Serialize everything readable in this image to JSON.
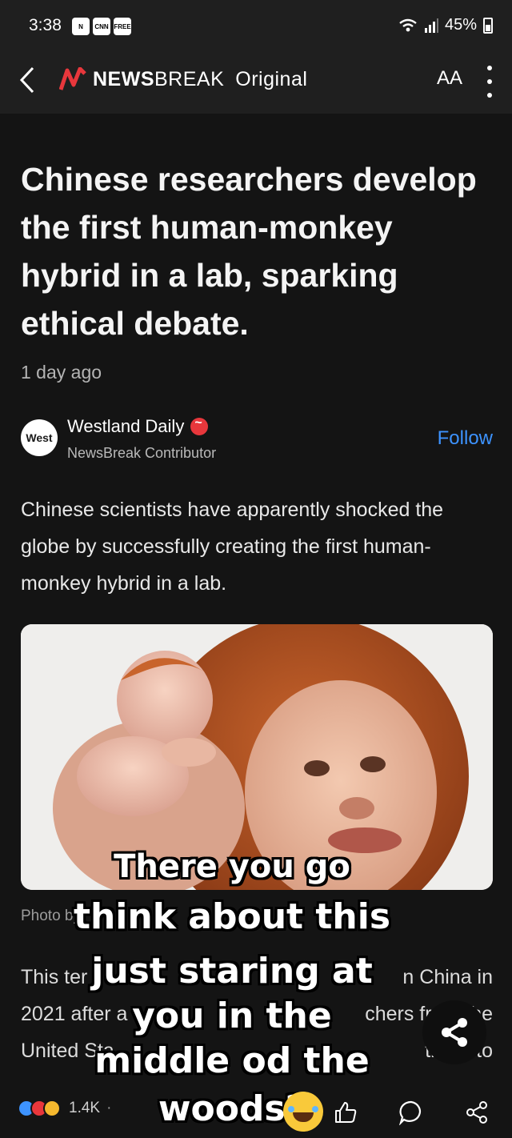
{
  "status_bar": {
    "time": "3:38",
    "badges": [
      "N",
      "CNN",
      "FREE"
    ],
    "battery": "45%"
  },
  "app_bar": {
    "brand_bold": "NEWS",
    "brand_light": "BREAK",
    "brand_suffix": "Original",
    "text_size_label": "AA",
    "brand_color": "#e8373c"
  },
  "article": {
    "headline": "Chinese researchers develop the first human-monkey hybrid in a lab, sparking ethical debate.",
    "time_ago": "1 day ago",
    "author": {
      "avatar_text": "West",
      "name": "Westland Daily",
      "role": "NewsBreak Contributor",
      "follow_label": "Follow"
    },
    "intro": "Chinese scientists have apparently shocked the globe by successfully creating the first human-monkey hybrid in a lab.",
    "photo_caption": "Photo by",
    "para2_lines": [
      "This ter",
      "n China in",
      "2021 after a",
      "chers from the",
      "United Sta",
      "there to"
    ]
  },
  "meme_overlay": {
    "line1": "There you go",
    "line2": "think about this",
    "line3": "just staring at",
    "line4": "you in the",
    "line5": "middle od the",
    "line6": "woods?"
  },
  "bottom_bar": {
    "reaction_count": "1.4K",
    "separator": "·"
  },
  "colors": {
    "accent_blue": "#3d93ff",
    "background": "#141414",
    "bar_background": "#1f1f1f"
  }
}
